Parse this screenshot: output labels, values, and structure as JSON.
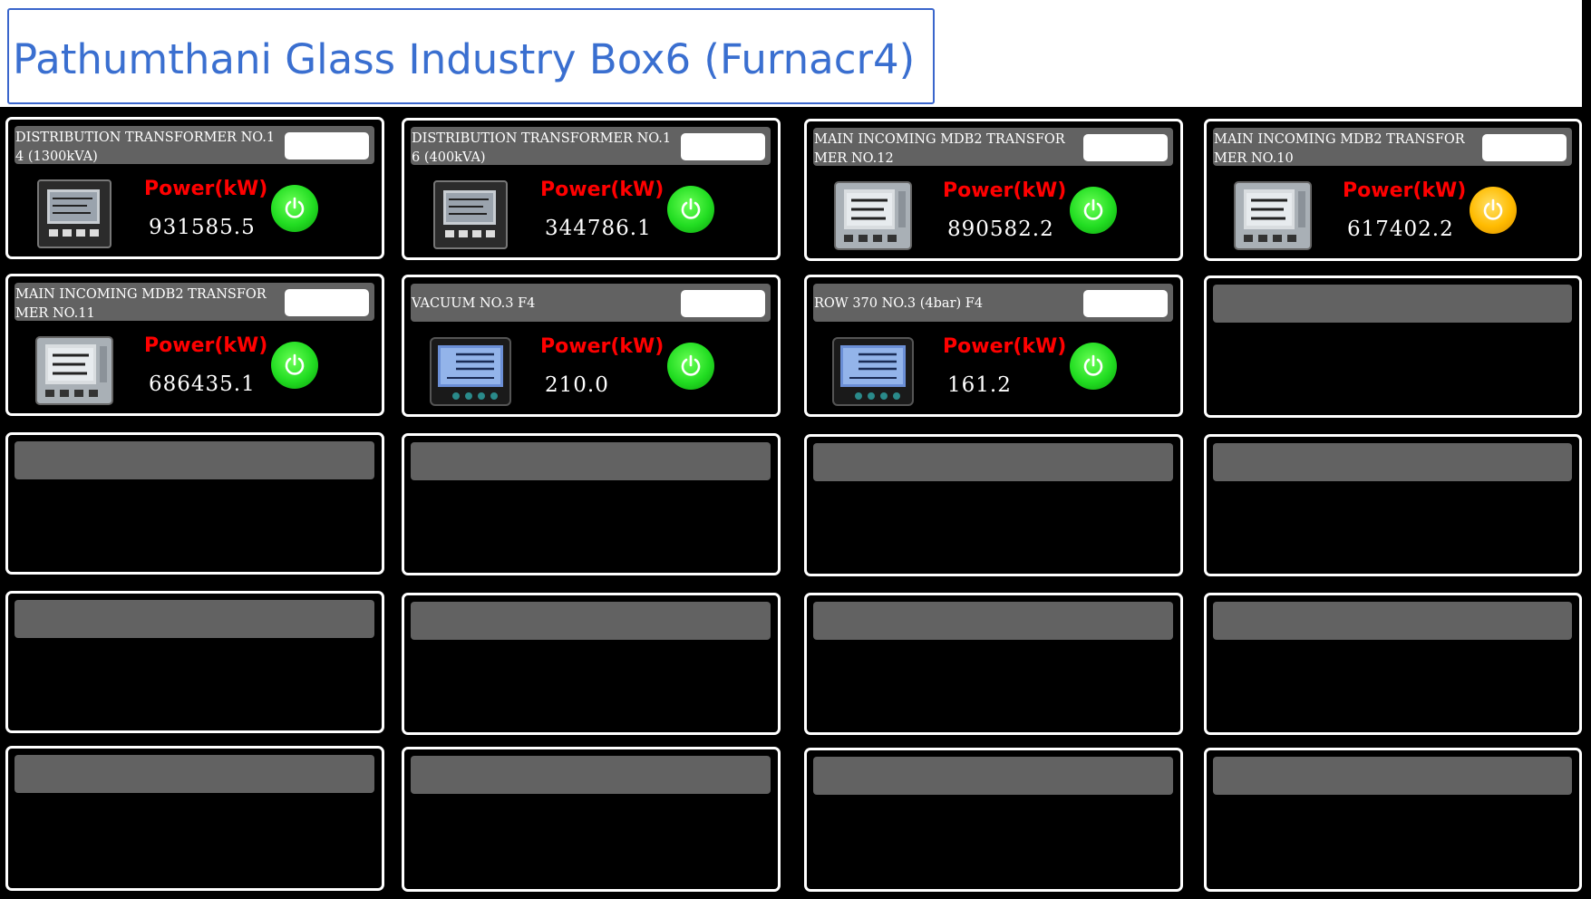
{
  "header": {
    "title": "Pathumthani Glass Industry Box6 (Furnacr4)"
  },
  "panels": [
    {
      "label": "DISTRIBUTION TRANSFORMER NO.14 (1300kVA)",
      "power_label": "Power(kW)",
      "value": "931585.5",
      "status": "green",
      "meter": "square-meter"
    },
    {
      "label": "DISTRIBUTION TRANSFORMER NO.16 (400kVA)",
      "power_label": "Power(kW)",
      "value": "344786.1",
      "status": "green",
      "meter": "square-meter"
    },
    {
      "label": "MAIN INCOMING MDB2 TRANSFORMER NO.12",
      "power_label": "Power(kW)",
      "value": "890582.2",
      "status": "green",
      "meter": "digital-meter"
    },
    {
      "label": "MAIN INCOMING MDB2 TRANSFORMER NO.10",
      "power_label": "Power(kW)",
      "value": "617402.2",
      "status": "amber",
      "meter": "digital-meter"
    },
    {
      "label": "MAIN INCOMING MDB2 TRANSFORMER NO.11",
      "power_label": "Power(kW)",
      "value": "686435.1",
      "status": "green",
      "meter": "digital-meter"
    },
    {
      "label": "VACUUM NO.3 F4",
      "power_label": "Power(kW)",
      "value": "210.0",
      "status": "green",
      "meter": "lcd-meter"
    },
    {
      "label": "ROW 370 NO.3 (4bar) F4",
      "power_label": "Power(kW)",
      "value": "161.2",
      "status": "green",
      "meter": "lcd-meter"
    }
  ],
  "colors": {
    "title": "#3a6fd0",
    "power_label": "#ff0000",
    "status_green": "#22dd22",
    "status_amber": "#ffbb00",
    "panel_header": "#626262"
  }
}
